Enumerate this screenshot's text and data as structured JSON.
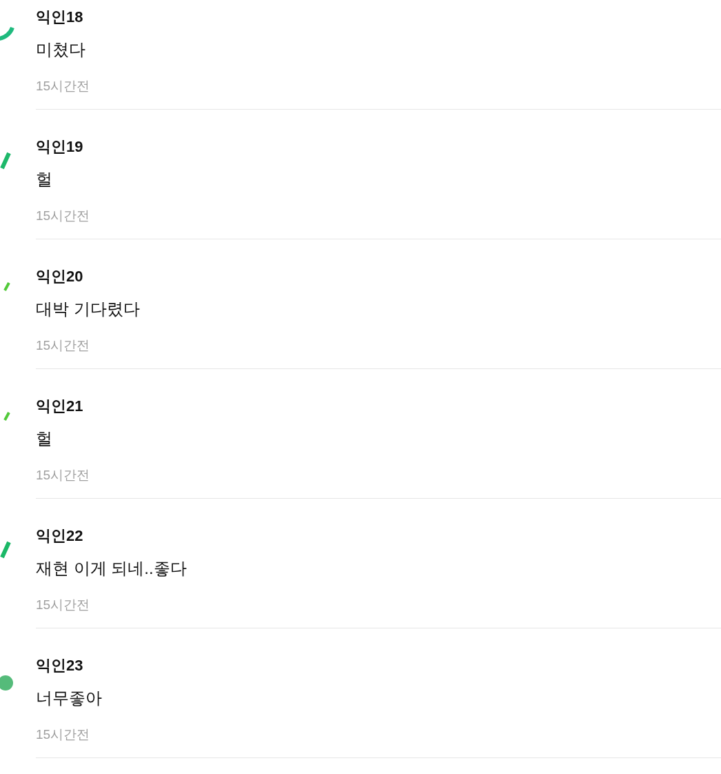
{
  "comments": [
    {
      "author": "익인18",
      "text": "미쳤다",
      "time": "15시간전",
      "avatar": {
        "kind": "arc",
        "color": "#1fba7e"
      }
    },
    {
      "author": "익인19",
      "text": "헐",
      "time": "15시간전",
      "avatar": {
        "kind": "slash",
        "color": "#1db86a"
      }
    },
    {
      "author": "익인20",
      "text": "대박 기다렸다",
      "time": "15시간전",
      "avatar": {
        "kind": "tick",
        "color": "#52c93a"
      }
    },
    {
      "author": "익인21",
      "text": "헐",
      "time": "15시간전",
      "avatar": {
        "kind": "tick",
        "color": "#52c93a"
      }
    },
    {
      "author": "익인22",
      "text": "재현 이게 되네..좋다",
      "time": "15시간전",
      "avatar": {
        "kind": "slash",
        "color": "#1bb867"
      }
    },
    {
      "author": "익인23",
      "text": "너무좋아",
      "time": "15시간전",
      "avatar": {
        "kind": "dot",
        "color": "#55bb7a"
      }
    }
  ]
}
